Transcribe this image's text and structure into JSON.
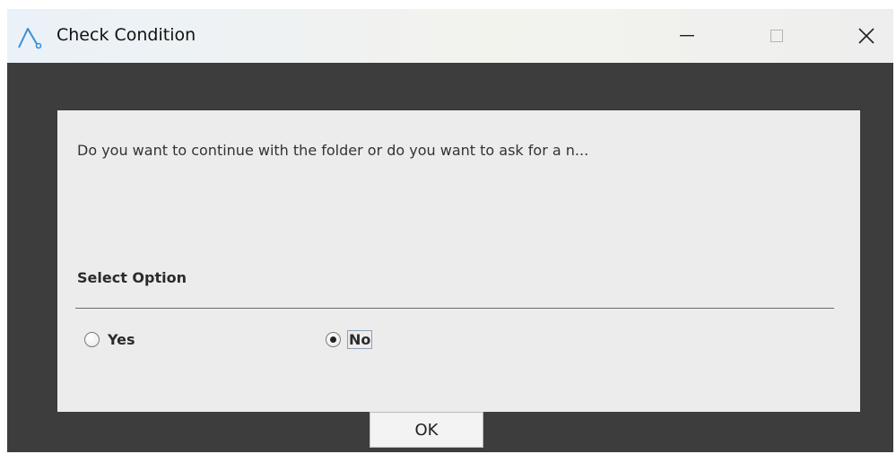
{
  "window": {
    "title": "Check Condition",
    "icon": "app-a-icon"
  },
  "titlebar_buttons": {
    "minimize": "minimize-icon",
    "maximize": "maximize-icon",
    "close": "close-icon"
  },
  "dialog": {
    "question": "Do you want to continue with the folder or do you want to ask for a n...",
    "select_label": "Select Option",
    "options": [
      {
        "label": "Yes",
        "selected": false
      },
      {
        "label": "No",
        "selected": true
      }
    ],
    "ok_label": "OK"
  },
  "colors": {
    "window_bg": "#3d3d3d",
    "panel_bg": "#ececec",
    "icon_accent": "#3a8fd6"
  }
}
